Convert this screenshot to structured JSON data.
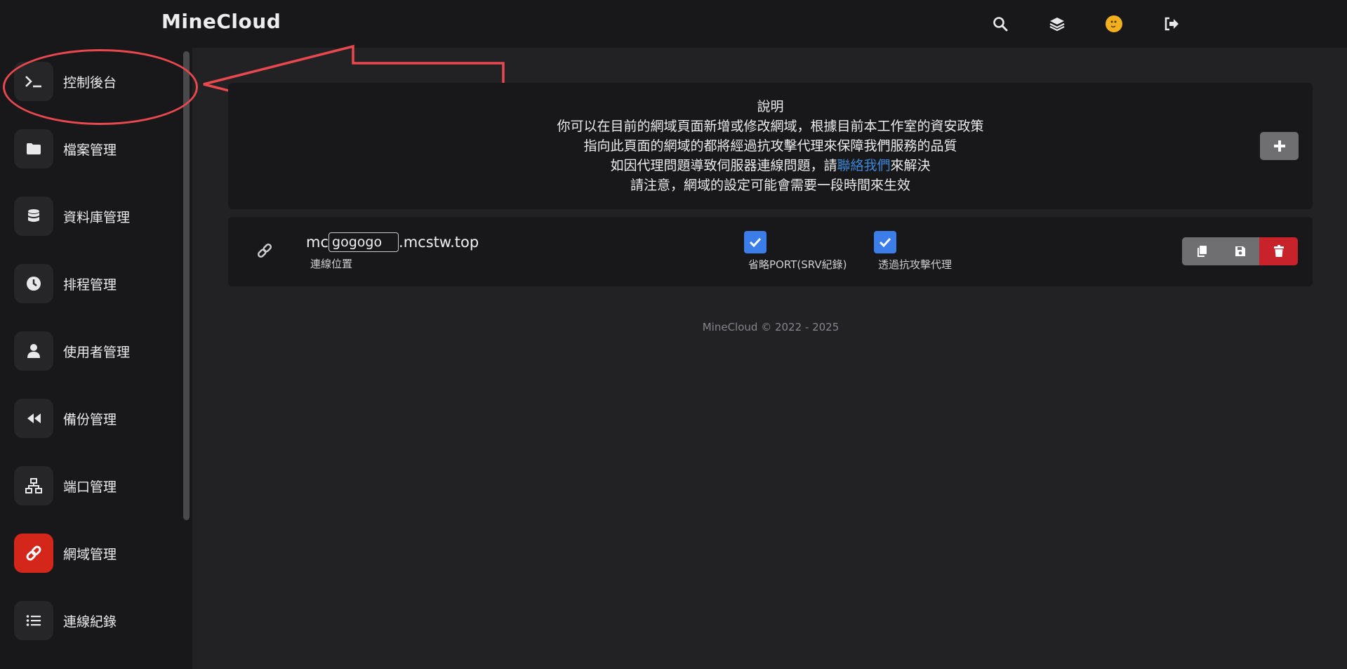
{
  "app": {
    "title": "MineCloud"
  },
  "topbar_icons": [
    "search-icon",
    "layers-icon",
    "avatar",
    "logout-icon"
  ],
  "sidebar": {
    "items": [
      {
        "label": "控制後台",
        "icon": "terminal-icon",
        "active": false
      },
      {
        "label": "檔案管理",
        "icon": "folder-icon",
        "active": false
      },
      {
        "label": "資料庫管理",
        "icon": "database-icon",
        "active": false
      },
      {
        "label": "排程管理",
        "icon": "clock-icon",
        "active": false
      },
      {
        "label": "使用者管理",
        "icon": "user-icon",
        "active": false
      },
      {
        "label": "備份管理",
        "icon": "rewind-icon",
        "active": false
      },
      {
        "label": "端口管理",
        "icon": "network-icon",
        "active": false
      },
      {
        "label": "網域管理",
        "icon": "link-icon",
        "active": true
      },
      {
        "label": "連線紀錄",
        "icon": "list-icon",
        "active": false
      }
    ]
  },
  "info": {
    "title": "說明",
    "line1": "你可以在目前的網域頁面新增或修改網域，根據目前本工作室的資安政策",
    "line2": "指向此頁面的網域的都將經過抗攻擊代理來保障我們服務的品質",
    "line3_before": "如因代理問題導致伺服器連線問題，請",
    "line3_link": "聯絡我們",
    "line3_after": "來解決",
    "line4": "請注意，網域的設定可能會需要一段時間來生效"
  },
  "domain": {
    "prefix": "mc",
    "subdomain": "gogogo",
    "suffix": ".mcstw.top",
    "location_label": "連線位置",
    "omit_port_label": "省略PORT(SRV紀錄)",
    "omit_port_checked": true,
    "proxy_label": "透過抗攻擊代理",
    "proxy_checked": true
  },
  "footer": {
    "text": "MineCloud © 2022 - 2025"
  },
  "colors": {
    "accent_red": "#d5261c",
    "delete_red": "#c8232a",
    "checkbox_blue": "#3b7de9",
    "link_blue": "#3d86d6",
    "annotation_red": "#e8484e"
  }
}
